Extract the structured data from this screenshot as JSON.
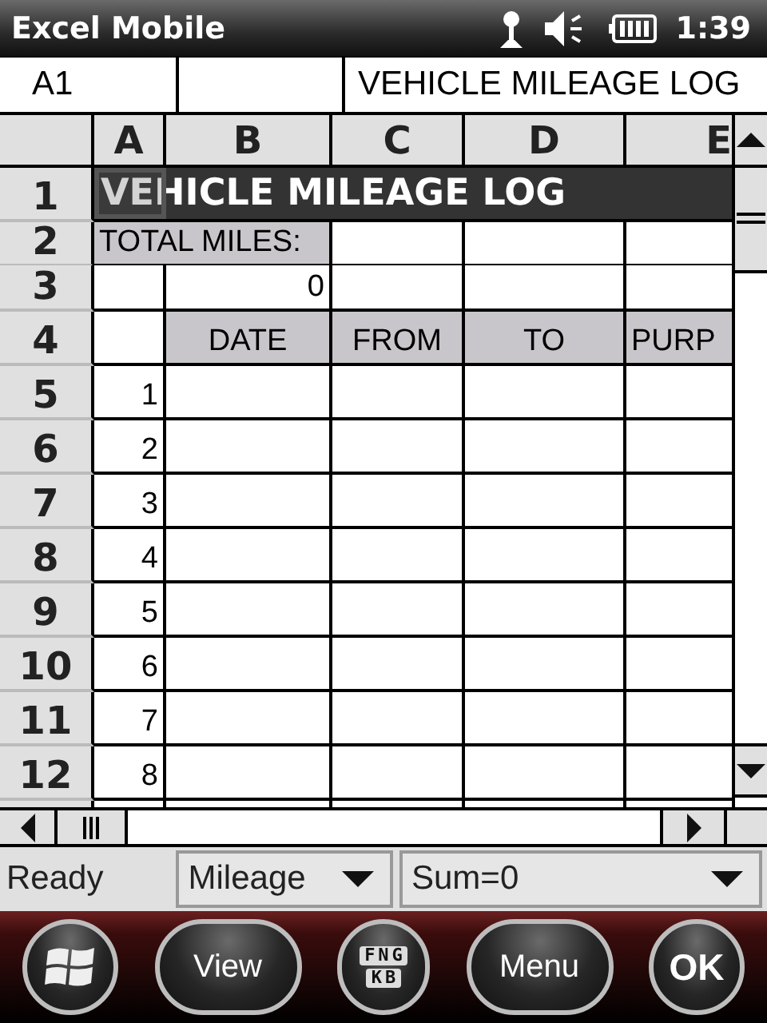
{
  "title_bar": {
    "app_title": "Excel Mobile",
    "time": "1:39"
  },
  "formula_bar": {
    "cell_ref": "A1",
    "content": "VEHICLE MILEAGE LOG"
  },
  "columns": [
    "A",
    "B",
    "C",
    "D",
    "E"
  ],
  "rows": [
    {
      "header": "1",
      "kind": "title",
      "text": "VEHICLE MILEAGE LOG"
    },
    {
      "header": "2",
      "kind": "label",
      "text": "TOTAL MILES:"
    },
    {
      "header": "3",
      "kind": "cells",
      "cells": [
        {
          "shaded": false
        },
        {
          "text": "0",
          "shaded": false
        },
        {
          "shaded": false
        },
        {
          "shaded": false
        },
        {
          "shaded": false
        }
      ]
    },
    {
      "header": "4",
      "kind": "cells",
      "cells": [
        {
          "shaded": false
        },
        {
          "text": "DATE",
          "shaded": true
        },
        {
          "text": "FROM",
          "shaded": true
        },
        {
          "text": "TO",
          "shaded": true
        },
        {
          "text": "PURP",
          "shaded": true
        }
      ]
    },
    {
      "header": "5",
      "kind": "cells",
      "cells": [
        {
          "text": "1",
          "shaded": false
        },
        {
          "shaded": false
        },
        {
          "shaded": false
        },
        {
          "shaded": false
        },
        {
          "shaded": false
        }
      ]
    },
    {
      "header": "6",
      "kind": "cells",
      "cells": [
        {
          "text": "2",
          "shaded": false
        },
        {
          "shaded": false
        },
        {
          "shaded": false
        },
        {
          "shaded": false
        },
        {
          "shaded": false
        }
      ]
    },
    {
      "header": "7",
      "kind": "cells",
      "cells": [
        {
          "text": "3",
          "shaded": false
        },
        {
          "shaded": false
        },
        {
          "shaded": false
        },
        {
          "shaded": false
        },
        {
          "shaded": false
        }
      ]
    },
    {
      "header": "8",
      "kind": "cells",
      "cells": [
        {
          "text": "4",
          "shaded": false
        },
        {
          "shaded": false
        },
        {
          "shaded": false
        },
        {
          "shaded": false
        },
        {
          "shaded": false
        }
      ]
    },
    {
      "header": "9",
      "kind": "cells",
      "cells": [
        {
          "text": "5",
          "shaded": false
        },
        {
          "shaded": false
        },
        {
          "shaded": false
        },
        {
          "shaded": false
        },
        {
          "shaded": false
        }
      ]
    },
    {
      "header": "10",
      "kind": "cells",
      "cells": [
        {
          "text": "6",
          "shaded": false
        },
        {
          "shaded": false
        },
        {
          "shaded": false
        },
        {
          "shaded": false
        },
        {
          "shaded": false
        }
      ]
    },
    {
      "header": "11",
      "kind": "cells",
      "cells": [
        {
          "text": "7",
          "shaded": false
        },
        {
          "shaded": false
        },
        {
          "shaded": false
        },
        {
          "shaded": false
        },
        {
          "shaded": false
        }
      ]
    },
    {
      "header": "12",
      "kind": "cells",
      "cells": [
        {
          "text": "8",
          "shaded": false
        },
        {
          "shaded": false
        },
        {
          "shaded": false
        },
        {
          "shaded": false
        },
        {
          "shaded": false
        }
      ]
    }
  ],
  "status_bar": {
    "state": "Ready",
    "sheet": "Mileage",
    "summary": "Sum=0"
  },
  "soft_keys": [
    {
      "kind": "start"
    },
    {
      "kind": "pill",
      "label": "View"
    },
    {
      "kind": "keyboard",
      "top": "FNG",
      "bottom": "KB"
    },
    {
      "kind": "pill",
      "label": "Menu"
    },
    {
      "kind": "round",
      "label": "OK"
    }
  ]
}
